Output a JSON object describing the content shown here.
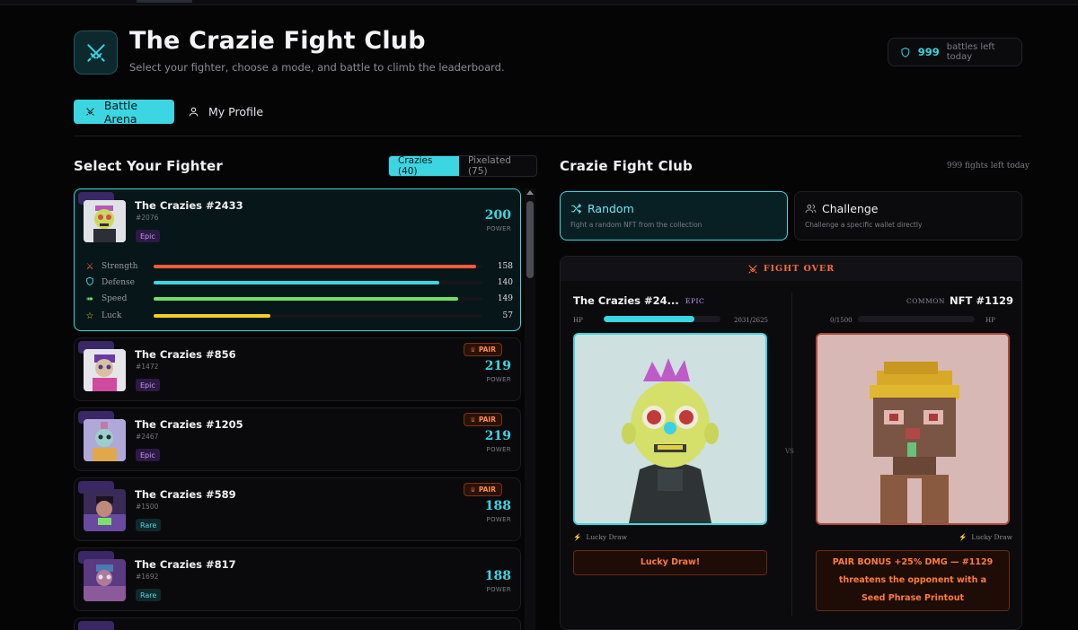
{
  "header": {
    "title": "The Crazie Fight Club",
    "subtitle": "Select your fighter, choose a mode, and battle to climb the leaderboard.",
    "battles_count": "999",
    "battles_text": "battles left today"
  },
  "tabs": [
    {
      "label": "Battle Arena",
      "icon": "crossed-swords-icon",
      "active": true
    },
    {
      "label": "My Profile",
      "icon": "user-icon",
      "active": false
    }
  ],
  "fighters_section": {
    "title": "Select Your Fighter",
    "filters": [
      {
        "label": "Crazies (40)",
        "active": true
      },
      {
        "label": "Pixelated (75)",
        "active": false
      }
    ]
  },
  "fighters": [
    {
      "name": "The Crazies #2433",
      "id": "#2076",
      "rarity": "Epic",
      "power": "200",
      "power_label": "POWER",
      "pair": false,
      "selected": true,
      "stats": [
        {
          "name": "Strength",
          "value": 158,
          "icon": "swords-icon",
          "color": "#ff5a3c"
        },
        {
          "name": "Defense",
          "value": 140,
          "icon": "shield-icon",
          "color": "#3cd6e2"
        },
        {
          "name": "Speed",
          "value": 149,
          "icon": "speed-icon",
          "color": "#6ee06a"
        },
        {
          "name": "Luck",
          "value": 57,
          "icon": "star-icon",
          "color": "#f2d024"
        }
      ]
    },
    {
      "name": "The Crazies #856",
      "id": "#1472",
      "rarity": "Epic",
      "power": "219",
      "power_label": "POWER",
      "pair": true,
      "pair_label": "PAIR"
    },
    {
      "name": "The Crazies #1205",
      "id": "#2467",
      "rarity": "Epic",
      "power": "219",
      "power_label": "POWER",
      "pair": true,
      "pair_label": "PAIR"
    },
    {
      "name": "The Crazies #589",
      "id": "#1500",
      "rarity": "Rare",
      "power": "188",
      "power_label": "POWER",
      "pair": true,
      "pair_label": "PAIR"
    },
    {
      "name": "The Crazies #817",
      "id": "#1692",
      "rarity": "Rare",
      "power": "188",
      "power_label": "POWER",
      "pair": false
    }
  ],
  "arena": {
    "title": "Crazie Fight Club",
    "fights_left": "999 fights left today",
    "modes": [
      {
        "label": "Random",
        "desc": "Fight a random NFT from the collection",
        "icon": "shuffle-icon",
        "active": true
      },
      {
        "label": "Challenge",
        "desc": "Challenge a specific wallet directly",
        "icon": "users-icon",
        "active": false
      }
    ],
    "status": "FIGHT OVER",
    "vs": "VS",
    "player": {
      "name": "The Crazies #24...",
      "rarity": "EPIC",
      "hp_label": "HP",
      "hp_text": "2031/2625",
      "hp_fraction": 0.774,
      "lucky_label": "Lucky Draw",
      "message": "Lucky Draw!"
    },
    "opponent": {
      "name": "NFT #1129",
      "rarity": "COMMON",
      "hp_label": "HP",
      "hp_text": "0/1500",
      "hp_fraction": 0,
      "lucky_label": "Lucky Draw",
      "message": "PAIR BONUS +25% DMG — #1129 threatens the opponent with a Seed Phrase Printout"
    }
  },
  "colors": {
    "accent": "#3cd6e2",
    "danger": "#ff6b35",
    "epic": "#c79bf2",
    "background": "#050506"
  }
}
